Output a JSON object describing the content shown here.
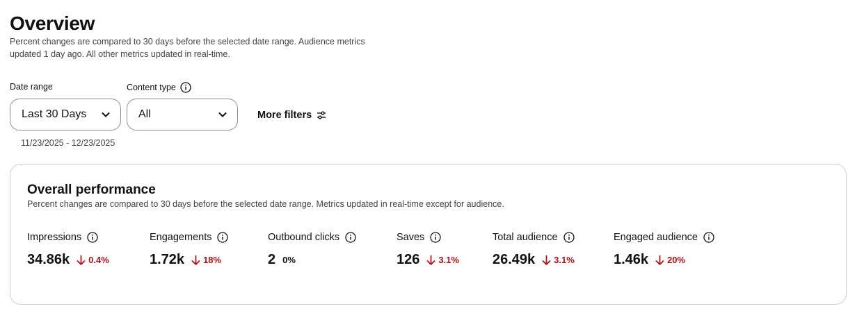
{
  "header": {
    "title": "Overview",
    "subtitle": "Percent changes are compared to 30 days before the selected date range. Audience metrics updated 1 day ago. All other metrics updated in real-time."
  },
  "filters": {
    "date_range": {
      "label": "Date range",
      "value": "Last 30 Days",
      "range_text": "11/23/2025 - 12/23/2025"
    },
    "content_type": {
      "label": "Content type",
      "value": "All"
    },
    "more_filters_label": "More filters"
  },
  "performance": {
    "title": "Overall performance",
    "subtitle": "Percent changes are compared to 30 days before the selected date range. Metrics updated in real-time except for audience.",
    "metrics": [
      {
        "label": "Impressions",
        "value": "34.86k",
        "change": "0.4%",
        "direction": "down"
      },
      {
        "label": "Engagements",
        "value": "1.72k",
        "change": "18%",
        "direction": "down"
      },
      {
        "label": "Outbound clicks",
        "value": "2",
        "change": "0%",
        "direction": "none"
      },
      {
        "label": "Saves",
        "value": "126",
        "change": "3.1%",
        "direction": "down"
      },
      {
        "label": "Total audience",
        "value": "26.49k",
        "change": "3.1%",
        "direction": "down"
      },
      {
        "label": "Engaged audience",
        "value": "1.46k",
        "change": "20%",
        "direction": "down"
      }
    ]
  },
  "colors": {
    "negative": "#b0111b",
    "border": "#cfcfcf",
    "text": "#111111"
  },
  "icons": {
    "info": "info-icon",
    "chevron": "chevron-down-icon",
    "filters": "sliders-icon",
    "decrease": "arrow-down-icon"
  }
}
